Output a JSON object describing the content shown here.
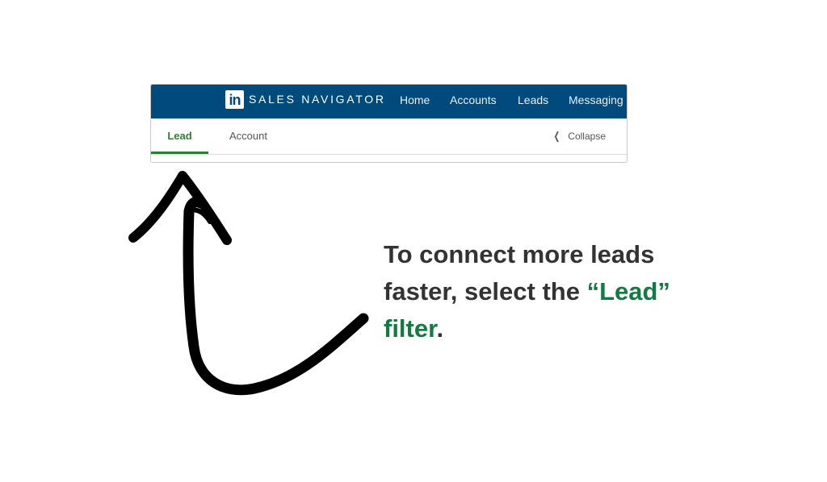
{
  "app": {
    "logo_text": "in",
    "brand": "SALES NAVIGATOR",
    "brand_color": "#004b7c",
    "nav": [
      "Home",
      "Accounts",
      "Leads",
      "Messaging"
    ]
  },
  "filter_tabs": {
    "active": "Lead",
    "items": [
      "Lead",
      "Account"
    ],
    "collapse_label": "Collapse",
    "active_color": "#2e7d32"
  },
  "instruction": {
    "part1": "To connect more leads faster, select the ",
    "highlight": "“Lead” filter",
    "part2": ".",
    "text_color": "#333333",
    "highlight_color": "#137a43"
  },
  "icons": [
    "linkedin-logo-icon",
    "chevron-left-icon",
    "hand-drawn-arrow-icon"
  ]
}
